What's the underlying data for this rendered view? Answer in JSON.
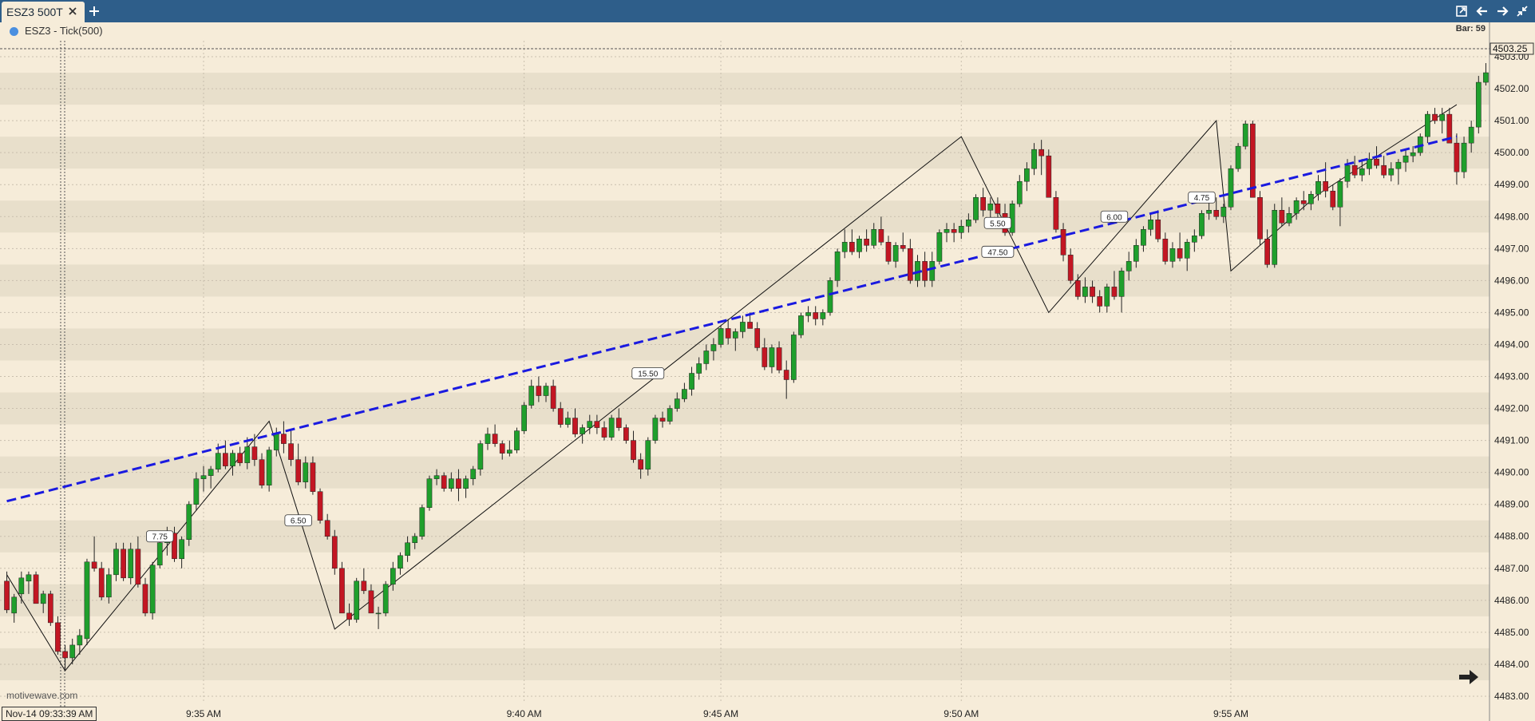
{
  "tab": {
    "title": "ESZ3 500T",
    "close_icon": "close-icon",
    "add_icon": "plus-icon"
  },
  "toolbar_icons": [
    "popout-icon",
    "arrow-left-icon",
    "arrow-right-icon",
    "collapse-icon"
  ],
  "header": {
    "series_label": "ESZ3 - Tick(500)",
    "bar_count": "Bar: 59"
  },
  "watermark": "motivewave.com",
  "cursor_date": "Nov-14 09:33:39 AM",
  "nav_icon": "go-to-end-arrow-icon",
  "colors": {
    "up": "#1f9f2c",
    "down": "#c31623",
    "trend": "#1a1ae0",
    "background": "#f6ecd9",
    "band": "#e8dfcb",
    "tab_bar": "#2e5e8a"
  },
  "chart_data": {
    "type": "candlestick",
    "y_axis": {
      "min": 4482.8,
      "max": 4503.5,
      "ticks": [
        "4503.00",
        "4502.00",
        "4501.00",
        "4500.00",
        "4499.00",
        "4498.00",
        "4497.00",
        "4496.00",
        "4495.00",
        "4494.00",
        "4493.00",
        "4492.00",
        "4491.00",
        "4490.00",
        "4489.00",
        "4488.00",
        "4487.00",
        "4486.00",
        "4485.00",
        "4484.00",
        "4483.00"
      ],
      "last_price": "4503.25"
    },
    "x_axis": {
      "ticks": [
        "9:35 AM",
        "9:40 AM",
        "9:45 AM",
        "9:50 AM",
        "9:55 AM"
      ],
      "tick_index": [
        27,
        71,
        98,
        131,
        168
      ]
    },
    "bars": [
      [
        4486.6,
        4486.9,
        4485.6,
        4485.7
      ],
      [
        4485.6,
        4486.2,
        4485.3,
        4486.1
      ],
      [
        4486.2,
        4486.9,
        4485.9,
        4486.7
      ],
      [
        4486.6,
        4486.9,
        4486.2,
        4486.8
      ],
      [
        4486.8,
        4486.9,
        4485.9,
        4485.9
      ],
      [
        4485.9,
        4486.3,
        4485.6,
        4486.2
      ],
      [
        4486.2,
        4486.3,
        4485.2,
        4485.3
      ],
      [
        4485.3,
        4485.5,
        4484.3,
        4484.4
      ],
      [
        4484.4,
        4484.6,
        4483.8,
        4484.2
      ],
      [
        4484.2,
        4484.8,
        4484.0,
        4484.6
      ],
      [
        4484.6,
        4485.1,
        4484.3,
        4484.9
      ],
      [
        4484.8,
        4487.3,
        4484.6,
        4487.2
      ],
      [
        4487.2,
        4488.0,
        4486.9,
        4487.0
      ],
      [
        4487.0,
        4487.2,
        4486.0,
        4486.1
      ],
      [
        4486.1,
        4487.0,
        4485.9,
        4486.8
      ],
      [
        4486.8,
        4487.8,
        4486.6,
        4487.6
      ],
      [
        4487.6,
        4487.8,
        4486.6,
        4486.7
      ],
      [
        4486.7,
        4487.8,
        4486.5,
        4487.6
      ],
      [
        4487.6,
        4488.0,
        4486.4,
        4486.5
      ],
      [
        4486.5,
        4486.7,
        4485.5,
        4485.6
      ],
      [
        4485.6,
        4487.2,
        4485.4,
        4487.1
      ],
      [
        4487.1,
        4488.0,
        4487.0,
        4487.8
      ],
      [
        4487.8,
        4488.3,
        4487.4,
        4488.1
      ],
      [
        4488.1,
        4488.3,
        4487.2,
        4487.3
      ],
      [
        4487.3,
        4488.0,
        4487.0,
        4487.9
      ],
      [
        4487.9,
        4489.1,
        4487.7,
        4489.0
      ],
      [
        4489.0,
        4490.0,
        4488.8,
        4489.8
      ],
      [
        4489.8,
        4490.2,
        4489.4,
        4489.9
      ],
      [
        4489.9,
        4490.2,
        4489.5,
        4490.1
      ],
      [
        4490.1,
        4490.9,
        4490.0,
        4490.6
      ],
      [
        4490.6,
        4491.0,
        4490.1,
        4490.2
      ],
      [
        4490.2,
        4490.7,
        4489.9,
        4490.6
      ],
      [
        4490.6,
        4490.8,
        4490.2,
        4490.3
      ],
      [
        4490.3,
        4491.1,
        4490.1,
        4490.8
      ],
      [
        4490.8,
        4491.2,
        4490.2,
        4490.4
      ],
      [
        4490.4,
        4490.6,
        4489.5,
        4489.6
      ],
      [
        4489.6,
        4490.8,
        4489.4,
        4490.7
      ],
      [
        4490.7,
        4491.4,
        4490.5,
        4491.2
      ],
      [
        4491.2,
        4491.6,
        4490.6,
        4490.9
      ],
      [
        4490.9,
        4491.3,
        4490.2,
        4490.4
      ],
      [
        4490.4,
        4490.9,
        4489.6,
        4489.7
      ],
      [
        4489.7,
        4490.5,
        4489.5,
        4490.3
      ],
      [
        4490.3,
        4490.5,
        4489.3,
        4489.4
      ],
      [
        4489.4,
        4489.5,
        4488.4,
        4488.5
      ],
      [
        4488.5,
        4488.7,
        4487.9,
        4488.0
      ],
      [
        4488.0,
        4488.2,
        4486.8,
        4487.0
      ],
      [
        4487.0,
        4487.2,
        4485.6,
        4485.6
      ],
      [
        4485.6,
        4485.9,
        4485.2,
        4485.4
      ],
      [
        4485.4,
        4486.7,
        4485.3,
        4486.6
      ],
      [
        4486.6,
        4487.0,
        4486.2,
        4486.3
      ],
      [
        4486.3,
        4486.5,
        4485.6,
        4485.6
      ],
      [
        4485.6,
        4485.8,
        4485.1,
        4485.6
      ],
      [
        4485.6,
        4486.6,
        4485.5,
        4486.5
      ],
      [
        4486.5,
        4487.2,
        4486.3,
        4487.0
      ],
      [
        4487.0,
        4487.5,
        4486.8,
        4487.4
      ],
      [
        4487.4,
        4488.0,
        4487.2,
        4487.8
      ],
      [
        4487.8,
        4488.1,
        4487.6,
        4488.0
      ],
      [
        4488.0,
        4489.0,
        4487.9,
        4488.9
      ],
      [
        4488.9,
        4489.9,
        4488.8,
        4489.8
      ],
      [
        4489.8,
        4490.1,
        4489.6,
        4489.9
      ],
      [
        4489.9,
        4490.0,
        4489.4,
        4489.5
      ],
      [
        4489.5,
        4490.0,
        4489.4,
        4489.8
      ],
      [
        4489.8,
        4490.1,
        4489.1,
        4489.5
      ],
      [
        4489.5,
        4489.9,
        4489.2,
        4489.8
      ],
      [
        4489.8,
        4490.2,
        4489.6,
        4490.1
      ],
      [
        4490.1,
        4491.0,
        4489.9,
        4490.9
      ],
      [
        4490.9,
        4491.4,
        4490.7,
        4491.2
      ],
      [
        4491.2,
        4491.5,
        4490.8,
        4490.9
      ],
      [
        4490.9,
        4491.0,
        4490.4,
        4490.6
      ],
      [
        4490.6,
        4491.0,
        4490.5,
        4490.7
      ],
      [
        4490.7,
        4491.4,
        4490.6,
        4491.3
      ],
      [
        4491.3,
        4492.2,
        4491.2,
        4492.1
      ],
      [
        4492.1,
        4492.9,
        4492.0,
        4492.7
      ],
      [
        4492.7,
        4493.0,
        4492.2,
        4492.4
      ],
      [
        4492.4,
        4492.8,
        4492.2,
        4492.7
      ],
      [
        4492.7,
        4492.9,
        4491.9,
        4492.0
      ],
      [
        4492.0,
        4492.2,
        4491.4,
        4491.5
      ],
      [
        4491.5,
        4491.9,
        4491.4,
        4491.7
      ],
      [
        4491.7,
        4492.0,
        4491.1,
        4491.2
      ],
      [
        4491.2,
        4491.5,
        4490.9,
        4491.4
      ],
      [
        4491.4,
        4491.8,
        4491.2,
        4491.6
      ],
      [
        4491.6,
        4491.8,
        4491.2,
        4491.4
      ],
      [
        4491.4,
        4491.6,
        4491.0,
        4491.1
      ],
      [
        4491.1,
        4491.8,
        4491.0,
        4491.7
      ],
      [
        4491.7,
        4492.0,
        4491.3,
        4491.4
      ],
      [
        4491.4,
        4491.5,
        4490.9,
        4491.0
      ],
      [
        4491.0,
        4491.3,
        4490.3,
        4490.4
      ],
      [
        4490.4,
        4490.6,
        4489.8,
        4490.1
      ],
      [
        4490.1,
        4491.1,
        4489.9,
        4491.0
      ],
      [
        4491.0,
        4491.8,
        4490.9,
        4491.7
      ],
      [
        4491.7,
        4491.9,
        4491.4,
        4491.6
      ],
      [
        4491.6,
        4492.1,
        4491.5,
        4492.0
      ],
      [
        4492.0,
        4492.5,
        4491.9,
        4492.3
      ],
      [
        4492.3,
        4492.8,
        4492.2,
        4492.6
      ],
      [
        4492.6,
        4493.3,
        4492.4,
        4493.1
      ],
      [
        4493.1,
        4493.6,
        4492.9,
        4493.4
      ],
      [
        4493.4,
        4494.0,
        4493.2,
        4493.8
      ],
      [
        4493.8,
        4494.2,
        4493.5,
        4494.0
      ],
      [
        4494.0,
        4494.6,
        4493.9,
        4494.5
      ],
      [
        4494.5,
        4494.8,
        4494.0,
        4494.2
      ],
      [
        4494.2,
        4494.5,
        4493.8,
        4494.4
      ],
      [
        4494.4,
        4494.9,
        4494.2,
        4494.7
      ],
      [
        4494.7,
        4495.0,
        4494.5,
        4494.5
      ],
      [
        4494.5,
        4494.7,
        4493.8,
        4493.9
      ],
      [
        4493.9,
        4494.2,
        4493.2,
        4493.3
      ],
      [
        4493.3,
        4494.0,
        4493.1,
        4493.9
      ],
      [
        4493.9,
        4494.1,
        4493.1,
        4493.2
      ],
      [
        4493.2,
        4493.5,
        4492.3,
        4492.9
      ],
      [
        4492.9,
        4494.4,
        4492.8,
        4494.3
      ],
      [
        4494.3,
        4495.0,
        4494.2,
        4494.9
      ],
      [
        4494.9,
        4495.2,
        4494.7,
        4495.0
      ],
      [
        4495.0,
        4495.2,
        4494.6,
        4494.8
      ],
      [
        4494.8,
        4495.1,
        4494.6,
        4495.0
      ],
      [
        4495.0,
        4496.1,
        4494.9,
        4496.0
      ],
      [
        4496.0,
        4497.0,
        4495.8,
        4496.9
      ],
      [
        4496.9,
        4497.6,
        4496.7,
        4497.2
      ],
      [
        4497.2,
        4497.6,
        4496.8,
        4496.9
      ],
      [
        4496.9,
        4497.4,
        4496.7,
        4497.3
      ],
      [
        4497.3,
        4497.6,
        4496.9,
        4497.1
      ],
      [
        4497.1,
        4497.8,
        4497.0,
        4497.6
      ],
      [
        4497.6,
        4498.0,
        4497.1,
        4497.2
      ],
      [
        4497.2,
        4497.4,
        4496.5,
        4496.6
      ],
      [
        4496.6,
        4497.2,
        4496.4,
        4497.1
      ],
      [
        4497.1,
        4497.5,
        4496.9,
        4497.0
      ],
      [
        4497.0,
        4497.3,
        4495.9,
        4496.0
      ],
      [
        4496.0,
        4496.8,
        4495.8,
        4496.6
      ],
      [
        4496.6,
        4496.9,
        4495.8,
        4496.0
      ],
      [
        4496.0,
        4496.9,
        4495.8,
        4496.6
      ],
      [
        4496.6,
        4497.6,
        4496.5,
        4497.5
      ],
      [
        4497.5,
        4497.8,
        4497.2,
        4497.6
      ],
      [
        4497.6,
        4497.8,
        4497.2,
        4497.5
      ],
      [
        4497.5,
        4497.9,
        4497.3,
        4497.7
      ],
      [
        4497.7,
        4498.1,
        4497.5,
        4497.9
      ],
      [
        4497.9,
        4498.7,
        4497.8,
        4498.6
      ],
      [
        4498.6,
        4498.9,
        4498.0,
        4498.2
      ],
      [
        4498.2,
        4498.6,
        4497.9,
        4498.4
      ],
      [
        4498.4,
        4498.6,
        4497.9,
        4498.1
      ],
      [
        4498.1,
        4498.4,
        4497.4,
        4497.5
      ],
      [
        4497.5,
        4498.5,
        4497.4,
        4498.4
      ],
      [
        4498.4,
        4499.3,
        4498.3,
        4499.1
      ],
      [
        4499.1,
        4499.7,
        4498.8,
        4499.5
      ],
      [
        4499.5,
        4500.3,
        4499.3,
        4500.1
      ],
      [
        4500.1,
        4500.4,
        4499.3,
        4499.9
      ],
      [
        4499.9,
        4500.1,
        4498.6,
        4498.6
      ],
      [
        4498.6,
        4498.8,
        4497.5,
        4497.6
      ],
      [
        4497.6,
        4497.8,
        4496.6,
        4496.8
      ],
      [
        4496.8,
        4497.0,
        4495.9,
        4496.0
      ],
      [
        4496.0,
        4496.2,
        4495.4,
        4495.5
      ],
      [
        4495.5,
        4496.1,
        4495.3,
        4495.8
      ],
      [
        4495.8,
        4496.0,
        4495.3,
        4495.5
      ],
      [
        4495.5,
        4495.7,
        4495.0,
        4495.2
      ],
      [
        4495.2,
        4495.9,
        4495.0,
        4495.8
      ],
      [
        4495.8,
        4496.3,
        4495.4,
        4495.5
      ],
      [
        4495.5,
        4496.4,
        4495.0,
        4496.3
      ],
      [
        4496.3,
        4496.9,
        4496.0,
        4496.6
      ],
      [
        4496.6,
        4497.3,
        4496.4,
        4497.1
      ],
      [
        4497.1,
        4497.7,
        4496.9,
        4497.6
      ],
      [
        4497.6,
        4498.1,
        4497.4,
        4497.9
      ],
      [
        4497.9,
        4498.2,
        4497.2,
        4497.3
      ],
      [
        4497.3,
        4497.5,
        4496.5,
        4496.6
      ],
      [
        4496.6,
        4497.2,
        4496.4,
        4497.0
      ],
      [
        4497.0,
        4497.5,
        4496.6,
        4496.7
      ],
      [
        4496.7,
        4497.3,
        4496.3,
        4497.2
      ],
      [
        4497.2,
        4497.6,
        4496.9,
        4497.4
      ],
      [
        4497.4,
        4498.2,
        4497.3,
        4498.1
      ],
      [
        4498.1,
        4498.5,
        4497.9,
        4498.2
      ],
      [
        4498.2,
        4498.6,
        4497.9,
        4498.0
      ],
      [
        4498.0,
        4498.4,
        4497.8,
        4498.3
      ],
      [
        4498.3,
        4499.6,
        4498.2,
        4499.5
      ],
      [
        4499.5,
        4500.3,
        4499.4,
        4500.2
      ],
      [
        4500.2,
        4501.0,
        4500.1,
        4500.9
      ],
      [
        4500.9,
        4501.0,
        4498.6,
        4498.6
      ],
      [
        4498.6,
        4498.8,
        4497.1,
        4497.3
      ],
      [
        4497.3,
        4497.6,
        4496.4,
        4496.5
      ],
      [
        4496.5,
        4498.4,
        4496.4,
        4498.2
      ],
      [
        4498.2,
        4498.6,
        4497.7,
        4497.8
      ],
      [
        4497.8,
        4498.3,
        4497.7,
        4498.1
      ],
      [
        4498.1,
        4498.6,
        4497.9,
        4498.5
      ],
      [
        4498.5,
        4498.8,
        4498.2,
        4498.4
      ],
      [
        4498.4,
        4498.8,
        4498.2,
        4498.7
      ],
      [
        4498.7,
        4499.3,
        4498.5,
        4499.1
      ],
      [
        4499.1,
        4499.7,
        4498.6,
        4498.8
      ],
      [
        4498.8,
        4499.0,
        4498.2,
        4498.3
      ],
      [
        4498.3,
        4499.2,
        4497.7,
        4499.1
      ],
      [
        4499.1,
        4499.8,
        4498.9,
        4499.6
      ],
      [
        4499.6,
        4499.9,
        4499.2,
        4499.3
      ],
      [
        4499.3,
        4499.8,
        4499.1,
        4499.5
      ],
      [
        4499.5,
        4500.0,
        4499.3,
        4499.8
      ],
      [
        4499.8,
        4500.2,
        4499.5,
        4499.6
      ],
      [
        4499.6,
        4499.9,
        4499.2,
        4499.3
      ],
      [
        4499.3,
        4499.7,
        4499.1,
        4499.5
      ],
      [
        4499.5,
        4499.8,
        4499.0,
        4499.7
      ],
      [
        4499.7,
        4500.1,
        4499.4,
        4499.9
      ],
      [
        4499.9,
        4500.2,
        4499.7,
        4500.0
      ],
      [
        4500.0,
        4500.6,
        4499.9,
        4500.5
      ],
      [
        4500.5,
        4501.3,
        4500.3,
        4501.2
      ],
      [
        4501.2,
        4501.4,
        4500.9,
        4501.0
      ],
      [
        4501.0,
        4501.4,
        4500.6,
        4501.2
      ],
      [
        4501.2,
        4501.4,
        4500.3,
        4500.3
      ],
      [
        4500.3,
        4500.6,
        4499.0,
        4499.4
      ],
      [
        4499.4,
        4500.5,
        4499.2,
        4500.3
      ],
      [
        4500.3,
        4501.0,
        4500.0,
        4500.8
      ],
      [
        4500.8,
        4502.4,
        4500.6,
        4502.2
      ],
      [
        4502.2,
        4502.8,
        4502.1,
        4502.5
      ]
    ],
    "trend_line": {
      "start": [
        0,
        4489.1
      ],
      "end": [
        199,
        4500.5
      ]
    },
    "zigzag": [
      [
        0,
        4486.8
      ],
      [
        8,
        4483.8
      ],
      [
        36,
        4491.6
      ],
      [
        45,
        4485.1
      ],
      [
        131,
        4500.5
      ],
      [
        143,
        4495.0
      ],
      [
        166,
        4501.0
      ],
      [
        168,
        4496.3
      ],
      [
        180,
        4498.7
      ],
      [
        199,
        4501.5
      ]
    ],
    "zigzag_labels": [
      {
        "index": 21,
        "price": 4488.0,
        "text": "7.75"
      },
      {
        "index": 40,
        "price": 4488.5,
        "text": "6.50"
      },
      {
        "index": 88,
        "price": 4493.1,
        "text": "15.50"
      },
      {
        "index": 136,
        "price": 4497.8,
        "text": "5.50"
      },
      {
        "index": 136,
        "price": 4496.9,
        "text": "47.50"
      },
      {
        "index": 152,
        "price": 4498.0,
        "text": "6.00"
      },
      {
        "index": 164,
        "price": 4498.6,
        "text": "4.75"
      }
    ]
  }
}
